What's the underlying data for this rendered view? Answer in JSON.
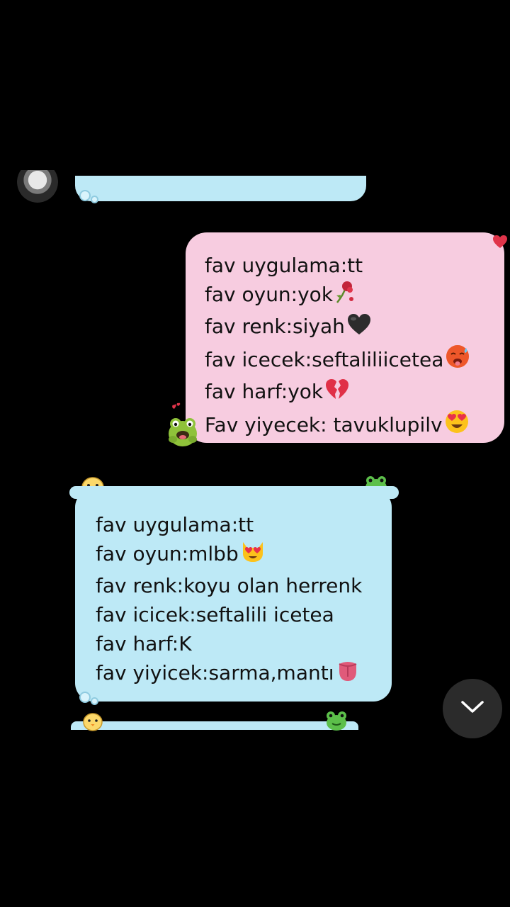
{
  "outgoing_message": {
    "lines": [
      {
        "text": "fav uygulama:tt",
        "emoji": ""
      },
      {
        "text": "fav oyun:yok",
        "emoji": "wilted-flower"
      },
      {
        "text": "fav renk:siyah",
        "emoji": "black-heart"
      },
      {
        "text": "fav icecek:seftaliliicetea",
        "emoji": "hot-face"
      },
      {
        "text": "fav harf:yok",
        "emoji": "broken-heart"
      },
      {
        "text": "Fav yiyecek: tavuklupilv",
        "emoji": "heart-eyes"
      }
    ],
    "bubble_color": "#f7cce0"
  },
  "incoming_message": {
    "lines": [
      {
        "text": "fav uygulama:tt",
        "emoji": ""
      },
      {
        "text": "fav oyun:mlbb",
        "emoji": "heart-eyes-cat"
      },
      {
        "text": "fav renk:koyu olan herrenk",
        "emoji": ""
      },
      {
        "text": "fav icicek:seftalili icetea",
        "emoji": ""
      },
      {
        "text": "fav harf:K",
        "emoji": ""
      },
      {
        "text": "fav yiyicek:sarma,mantı",
        "emoji": "tongue"
      }
    ],
    "bubble_color": "#bde9f6"
  },
  "scroll_button": {
    "icon": "chevron-down-icon"
  }
}
